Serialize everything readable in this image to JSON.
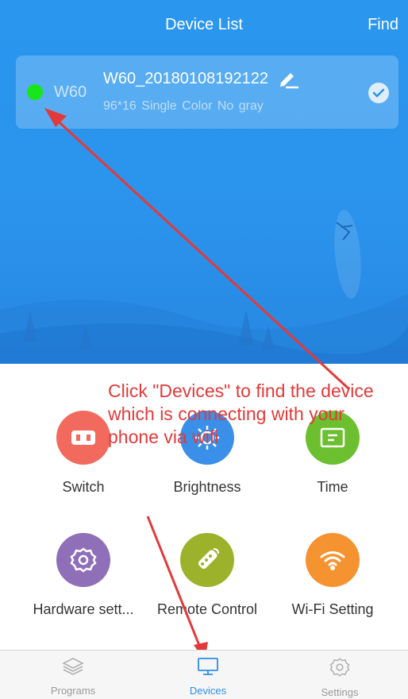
{
  "header": {
    "title": "Device List",
    "find_label": "Find"
  },
  "device": {
    "model": "W60",
    "name": "W60_20180108192122",
    "spec": "96*16  Single Color  No gray",
    "status_color": "#19e619",
    "selected": true
  },
  "callout": {
    "text": "Click \"Devices\" to find the device which is connecting with your phone via wifi"
  },
  "features": [
    {
      "label": "Switch",
      "icon": "plug-icon",
      "color": "#f26a5e"
    },
    {
      "label": "Brightness",
      "icon": "sun-icon",
      "color": "#3a8fe8"
    },
    {
      "label": "Time",
      "icon": "clock-icon",
      "color": "#6cbf2e"
    },
    {
      "label": "Hardware sett...",
      "icon": "gear-icon",
      "color": "#8f6fb8"
    },
    {
      "label": "Remote Control",
      "icon": "remote-icon",
      "color": "#9cb22b"
    },
    {
      "label": "Wi-Fi Setting",
      "icon": "wifi-icon",
      "color": "#f59330"
    }
  ],
  "tabs": [
    {
      "label": "Programs",
      "icon": "layers-icon",
      "active": false
    },
    {
      "label": "Devices",
      "icon": "monitor-icon",
      "active": true
    },
    {
      "label": "Settings",
      "icon": "gear-icon",
      "active": false
    }
  ],
  "colors": {
    "primary": "#2b93ec",
    "annotation": "#e23a3a",
    "tab_active": "#2b8fe8"
  }
}
